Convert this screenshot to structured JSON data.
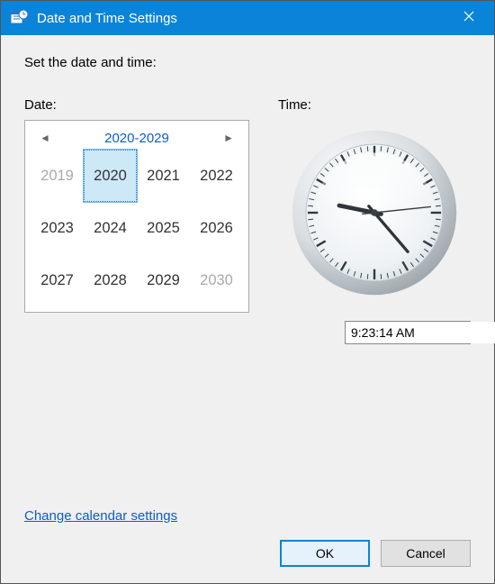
{
  "title": "Date and Time Settings",
  "instruction": "Set the date and time:",
  "date_label": "Date:",
  "time_label": "Time:",
  "calendar": {
    "range_title": "2020-2029",
    "cells": [
      {
        "label": "2019",
        "outside": true,
        "selected": false
      },
      {
        "label": "2020",
        "outside": false,
        "selected": true
      },
      {
        "label": "2021",
        "outside": false,
        "selected": false
      },
      {
        "label": "2022",
        "outside": false,
        "selected": false
      },
      {
        "label": "2023",
        "outside": false,
        "selected": false
      },
      {
        "label": "2024",
        "outside": false,
        "selected": false
      },
      {
        "label": "2025",
        "outside": false,
        "selected": false
      },
      {
        "label": "2026",
        "outside": false,
        "selected": false
      },
      {
        "label": "2027",
        "outside": false,
        "selected": false
      },
      {
        "label": "2028",
        "outside": false,
        "selected": false
      },
      {
        "label": "2029",
        "outside": false,
        "selected": false
      },
      {
        "label": "2030",
        "outside": true,
        "selected": false
      }
    ]
  },
  "time": {
    "display": "9:23:14 AM",
    "hours": 9,
    "minutes": 23,
    "seconds": 14
  },
  "link_text": "Change calendar settings",
  "ok_label": "OK",
  "cancel_label": "Cancel"
}
